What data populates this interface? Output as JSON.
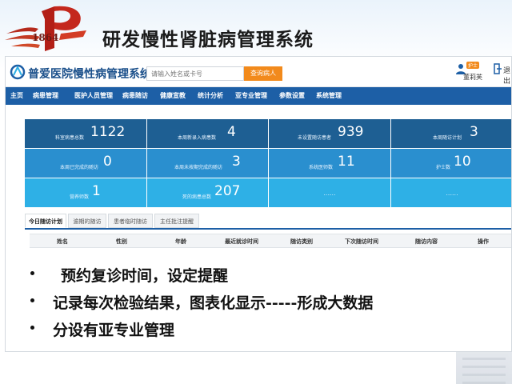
{
  "slide": {
    "title": "研发慢性肾脏病管理系统",
    "logo_year": "1864",
    "bullets": [
      "预约复诊时间，设定提醒",
      "记录每次检验结果，图表化显示-----形成大数据",
      "分设有亚专业管理"
    ]
  },
  "app": {
    "name": "普爱医院慢性病管理系统",
    "search": {
      "placeholder": "请输入姓名或卡号",
      "button": "查询病人"
    },
    "user": {
      "role": "护士",
      "name": "董莉芙",
      "exit_label": "退出"
    },
    "nav": [
      "主页",
      "病患管理",
      "医护人员管理",
      "病患随访",
      "健康宣教",
      "统计分析",
      "亚专业管理",
      "参数设置",
      "系统管理"
    ],
    "stats": [
      {
        "label": "科室病患总数",
        "value": "1122"
      },
      {
        "label": "本周新录入病患数",
        "value": "4"
      },
      {
        "label": "未设置随访患者",
        "value": "939"
      },
      {
        "label": "本周随访计划",
        "value": "3"
      },
      {
        "label": "本周已完成的随访",
        "value": "0"
      },
      {
        "label": "本周未按期完成的随访",
        "value": "3"
      },
      {
        "label": "系统医师数",
        "value": "11"
      },
      {
        "label": "护士数",
        "value": "10"
      },
      {
        "label": "营养师数",
        "value": "1"
      },
      {
        "label": "死的病患总数",
        "value": "207"
      },
      {
        "label": "",
        "value": "......"
      },
      {
        "label": "",
        "value": "......"
      }
    ],
    "tabs": [
      "今日随访计划",
      "逾期的随访",
      "患者临时随访",
      "主任批注提醒"
    ],
    "columns": [
      "姓名",
      "性别",
      "年龄",
      "最近就诊时间",
      "随访类别",
      "下次随访时间",
      "随访内容",
      "操作"
    ]
  },
  "colors": {
    "nav": "#1d5fa6",
    "stat_dark": "#1e5f93",
    "stat_mid": "#2a8fcf",
    "stat_light": "#2eb0e6",
    "accent": "#f28a1c"
  }
}
